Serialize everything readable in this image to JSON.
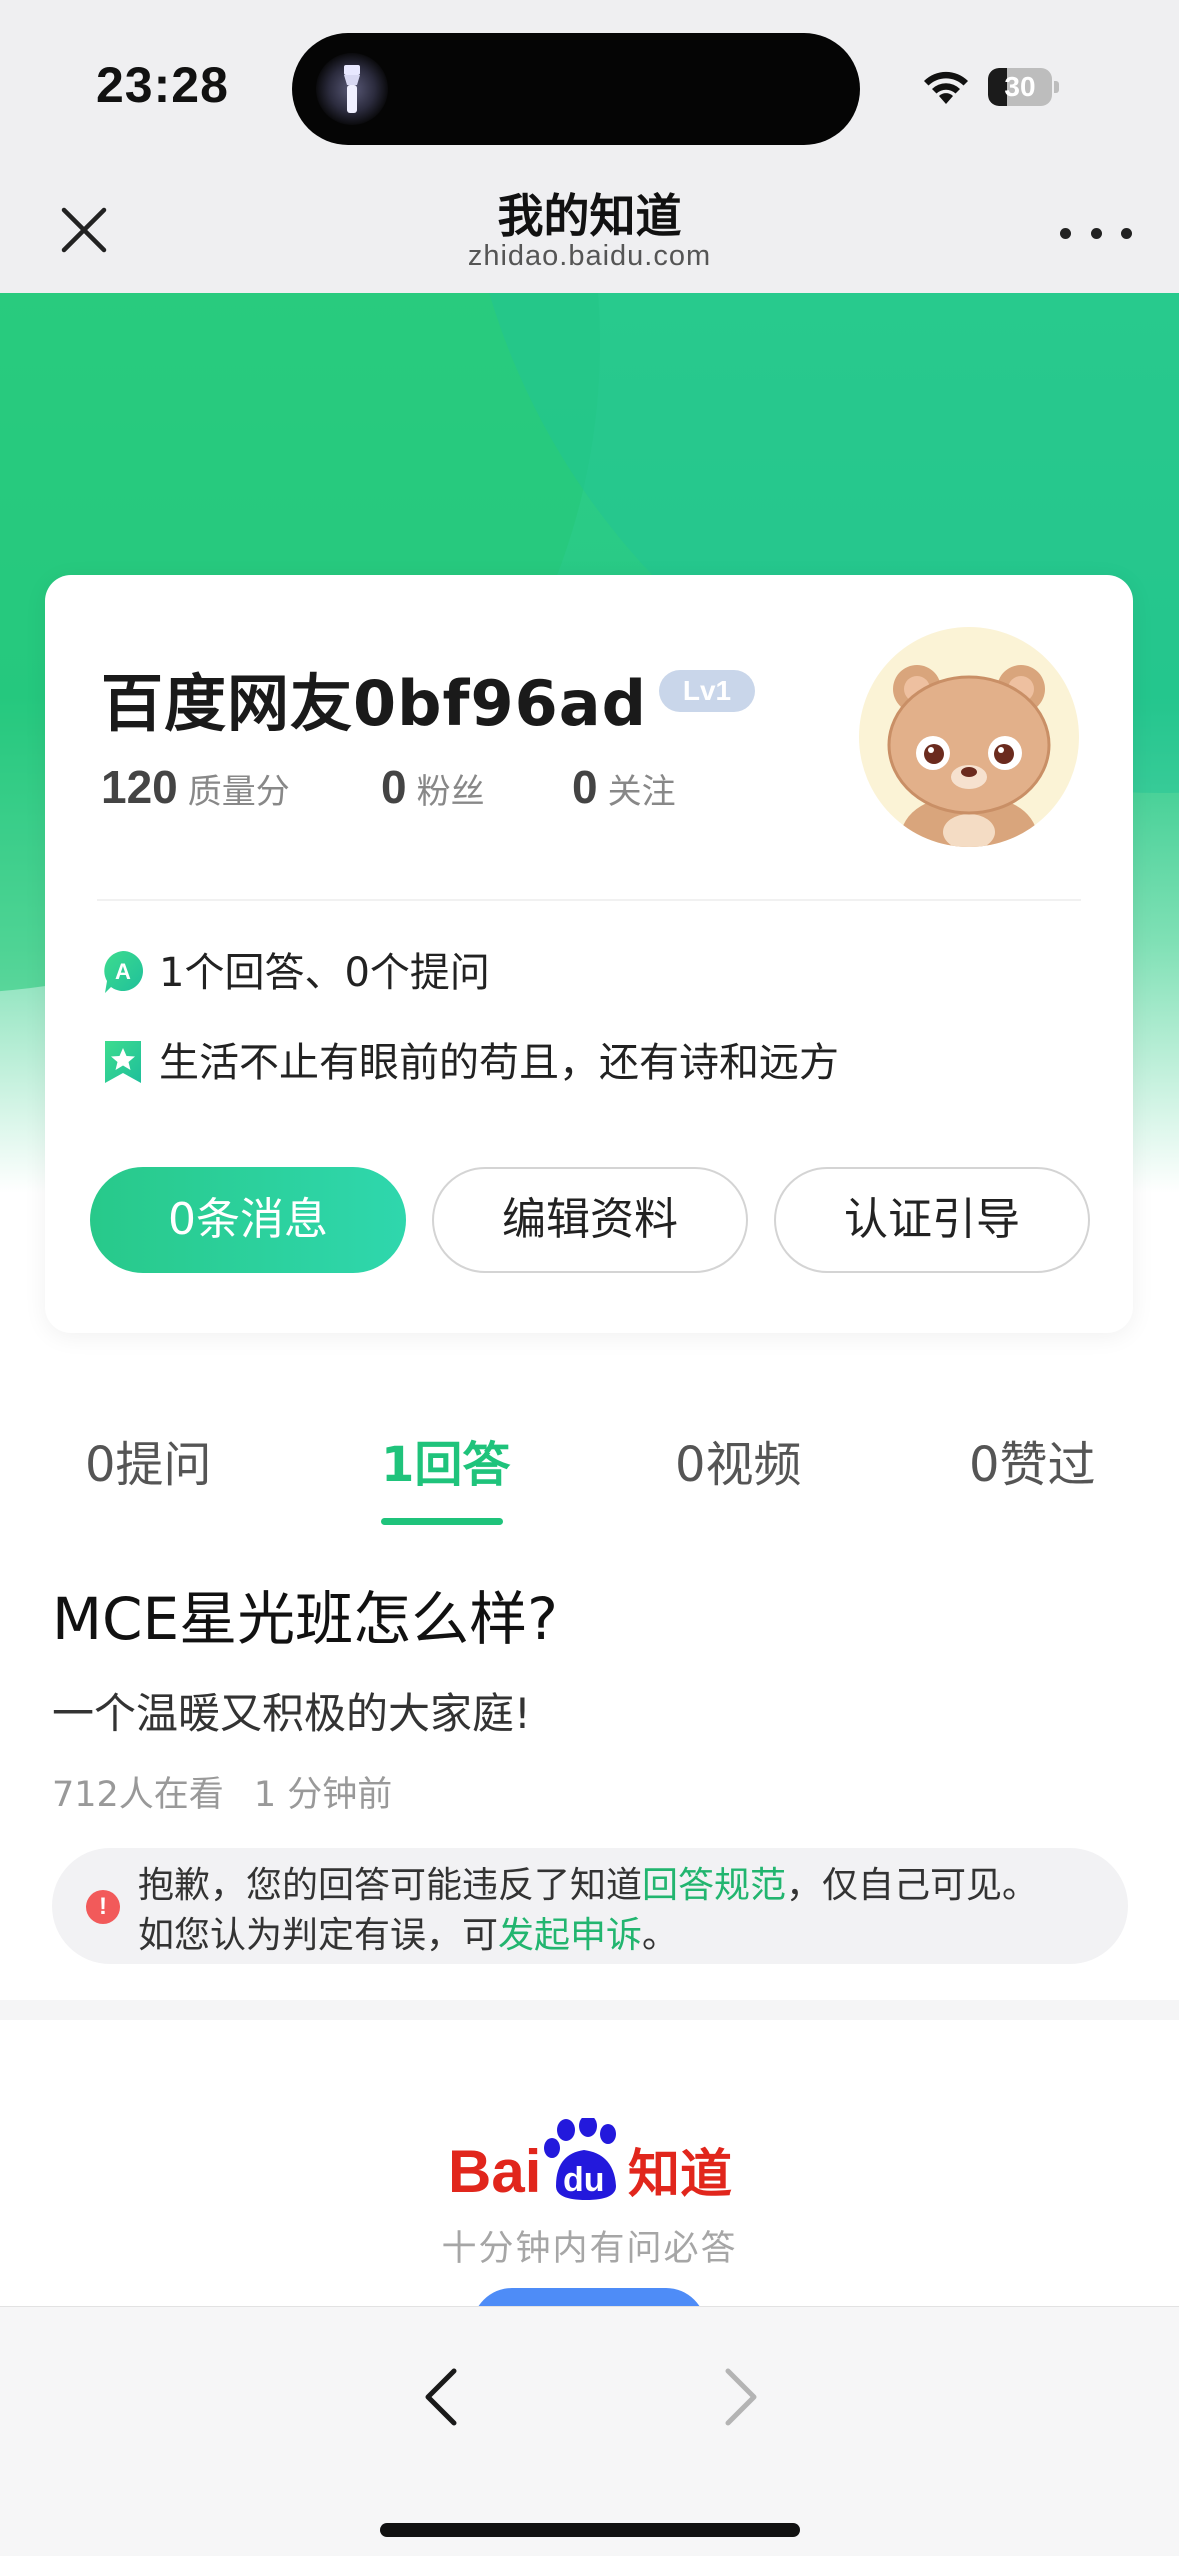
{
  "status_bar": {
    "time": "23:28",
    "battery": "30",
    "battery_level": 0.3,
    "icons": [
      "flashlight-icon",
      "wifi-icon",
      "battery-icon"
    ]
  },
  "header": {
    "title": "我的知道",
    "url": "zhidao.baidu.com",
    "close_icon": "close-icon",
    "more_icon": "more-dots-icon"
  },
  "profile": {
    "username": "百度网友0bf96ad",
    "level": "Lv1",
    "stats": [
      {
        "value": "120",
        "label": "质量分"
      },
      {
        "value": "0",
        "label": "粉丝"
      },
      {
        "value": "0",
        "label": "关注"
      }
    ],
    "summary": "1个回答、0个提问",
    "signature": "生活不止有眼前的苟且，还有诗和远方",
    "buttons": {
      "messages": "0条消息",
      "edit": "编辑资料",
      "verify": "认证引导"
    }
  },
  "tabs": [
    {
      "label": "0提问",
      "active": false
    },
    {
      "label": "1回答",
      "active": true
    },
    {
      "label": "0视频",
      "active": false
    },
    {
      "label": "0赞过",
      "active": false
    }
  ],
  "answer": {
    "question": "MCE星光班怎么样?",
    "content": "一个温暖又积极的大家庭!",
    "viewers": "712人在看",
    "time": "1 分钟前",
    "notice": {
      "icon": "!",
      "line1_before": "抱歉，您的回答可能违反了知道",
      "line1_link": "回答规范",
      "line1_after": "，仅自己可见。",
      "line2_before": "如您认为判定有误，可",
      "line2_link": "发起申诉",
      "line2_after": "。"
    }
  },
  "footer": {
    "brand_bai": "Bai",
    "brand_du": "du",
    "brand_zhidao": "知道",
    "tagline": "十分钟内有问必答"
  },
  "colors": {
    "accent_green": "#1fc37b",
    "notice_red": "#f25a5a",
    "baidu_red": "#e1261c",
    "baidu_blue": "#2319dc"
  }
}
